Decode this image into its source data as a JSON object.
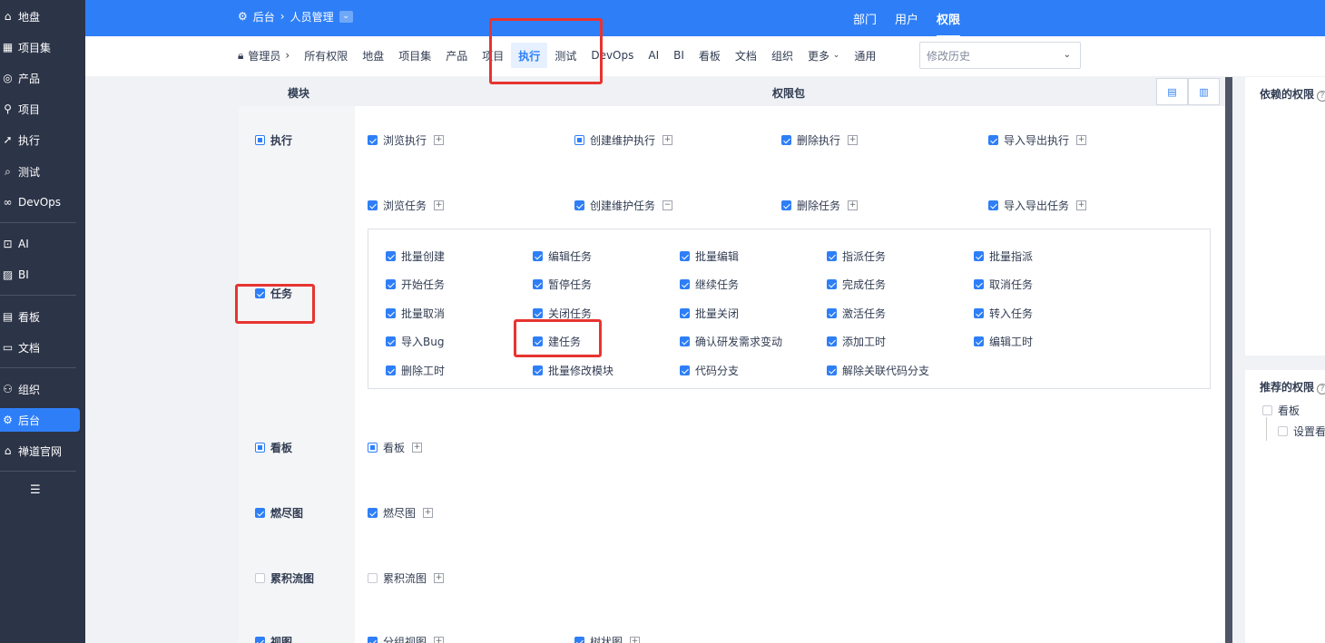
{
  "sidebar": {
    "items": [
      {
        "label": "地盘",
        "icon": "home-icon"
      },
      {
        "label": "项目集",
        "icon": "grid-icon"
      },
      {
        "label": "产品",
        "icon": "lightbulb-icon"
      },
      {
        "label": "项目",
        "icon": "rocket-icon"
      },
      {
        "label": "执行",
        "icon": "execution-icon"
      },
      {
        "label": "测试",
        "icon": "search-icon"
      },
      {
        "label": "DevOps",
        "icon": "infinity-icon"
      },
      {
        "label": "AI",
        "icon": "robot-icon"
      },
      {
        "label": "BI",
        "icon": "chart-icon"
      },
      {
        "label": "看板",
        "icon": "kanban-icon"
      },
      {
        "label": "文档",
        "icon": "document-icon"
      },
      {
        "label": "组织",
        "icon": "people-icon"
      },
      {
        "label": "后台",
        "icon": "gear-icon"
      },
      {
        "label": "禅道官网",
        "icon": "home-icon"
      }
    ],
    "active": "后台",
    "collapse_icon": "indent-icon"
  },
  "header": {
    "breadcrumb": [
      "后台",
      "人员管理"
    ],
    "tabs": [
      "部门",
      "用户",
      "权限"
    ],
    "active_tab": "权限"
  },
  "nav": {
    "admin": "管理员",
    "items": [
      "所有权限",
      "地盘",
      "项目集",
      "产品",
      "项目",
      "执行",
      "测试",
      "DevOps",
      "AI",
      "BI",
      "看板",
      "文档",
      "组织",
      "更多",
      "通用"
    ],
    "selected": "执行",
    "history_placeholder": "修改历史"
  },
  "table": {
    "col_module": "模块",
    "col_package": "权限包"
  },
  "modules": {
    "exec": {
      "name": "执行",
      "state": "part",
      "packages": [
        {
          "label": "浏览执行",
          "state": "on"
        },
        {
          "label": "创建维护执行",
          "state": "part"
        },
        {
          "label": "删除执行",
          "state": "on"
        },
        {
          "label": "导入导出执行",
          "state": "on"
        }
      ]
    },
    "task": {
      "name": "任务",
      "state": "on",
      "packages": [
        {
          "label": "浏览任务",
          "state": "on"
        },
        {
          "label": "创建维护任务",
          "state": "on",
          "expanded": true
        },
        {
          "label": "删除任务",
          "state": "on"
        },
        {
          "label": "导入导出任务",
          "state": "on"
        }
      ],
      "subitems": [
        [
          "批量创建",
          "编辑任务",
          "批量编辑",
          "指派任务",
          "批量指派"
        ],
        [
          "开始任务",
          "暂停任务",
          "继续任务",
          "完成任务",
          "取消任务"
        ],
        [
          "批量取消",
          "关闭任务",
          "批量关闭",
          "激活任务",
          "转入任务"
        ],
        [
          "导入Bug",
          "建任务",
          "确认研发需求变动",
          "添加工时",
          "编辑工时"
        ],
        [
          "删除工时",
          "批量修改模块",
          "代码分支",
          "解除关联代码分支"
        ]
      ]
    },
    "kanban": {
      "name": "看板",
      "state": "part",
      "packages": [
        {
          "label": "看板",
          "state": "part"
        }
      ]
    },
    "burn": {
      "name": "燃尽图",
      "state": "on",
      "packages": [
        {
          "label": "燃尽图",
          "state": "on"
        }
      ]
    },
    "cfd": {
      "name": "累积流图",
      "state": "off",
      "packages": [
        {
          "label": "累积流图",
          "state": "off"
        }
      ]
    },
    "view": {
      "name": "视图",
      "state": "on",
      "packages": [
        {
          "label": "分组视图",
          "state": "on"
        },
        {
          "label": "树状图",
          "state": "on"
        }
      ]
    }
  },
  "right": {
    "depend_title": "依赖的权限",
    "recommend_title": "推荐的权限",
    "recommend_items": [
      "看板",
      "设置看"
    ]
  },
  "colors": {
    "primary": "#2e7ff7",
    "sidebar": "#2c3447",
    "highlight": "#e7342f"
  }
}
